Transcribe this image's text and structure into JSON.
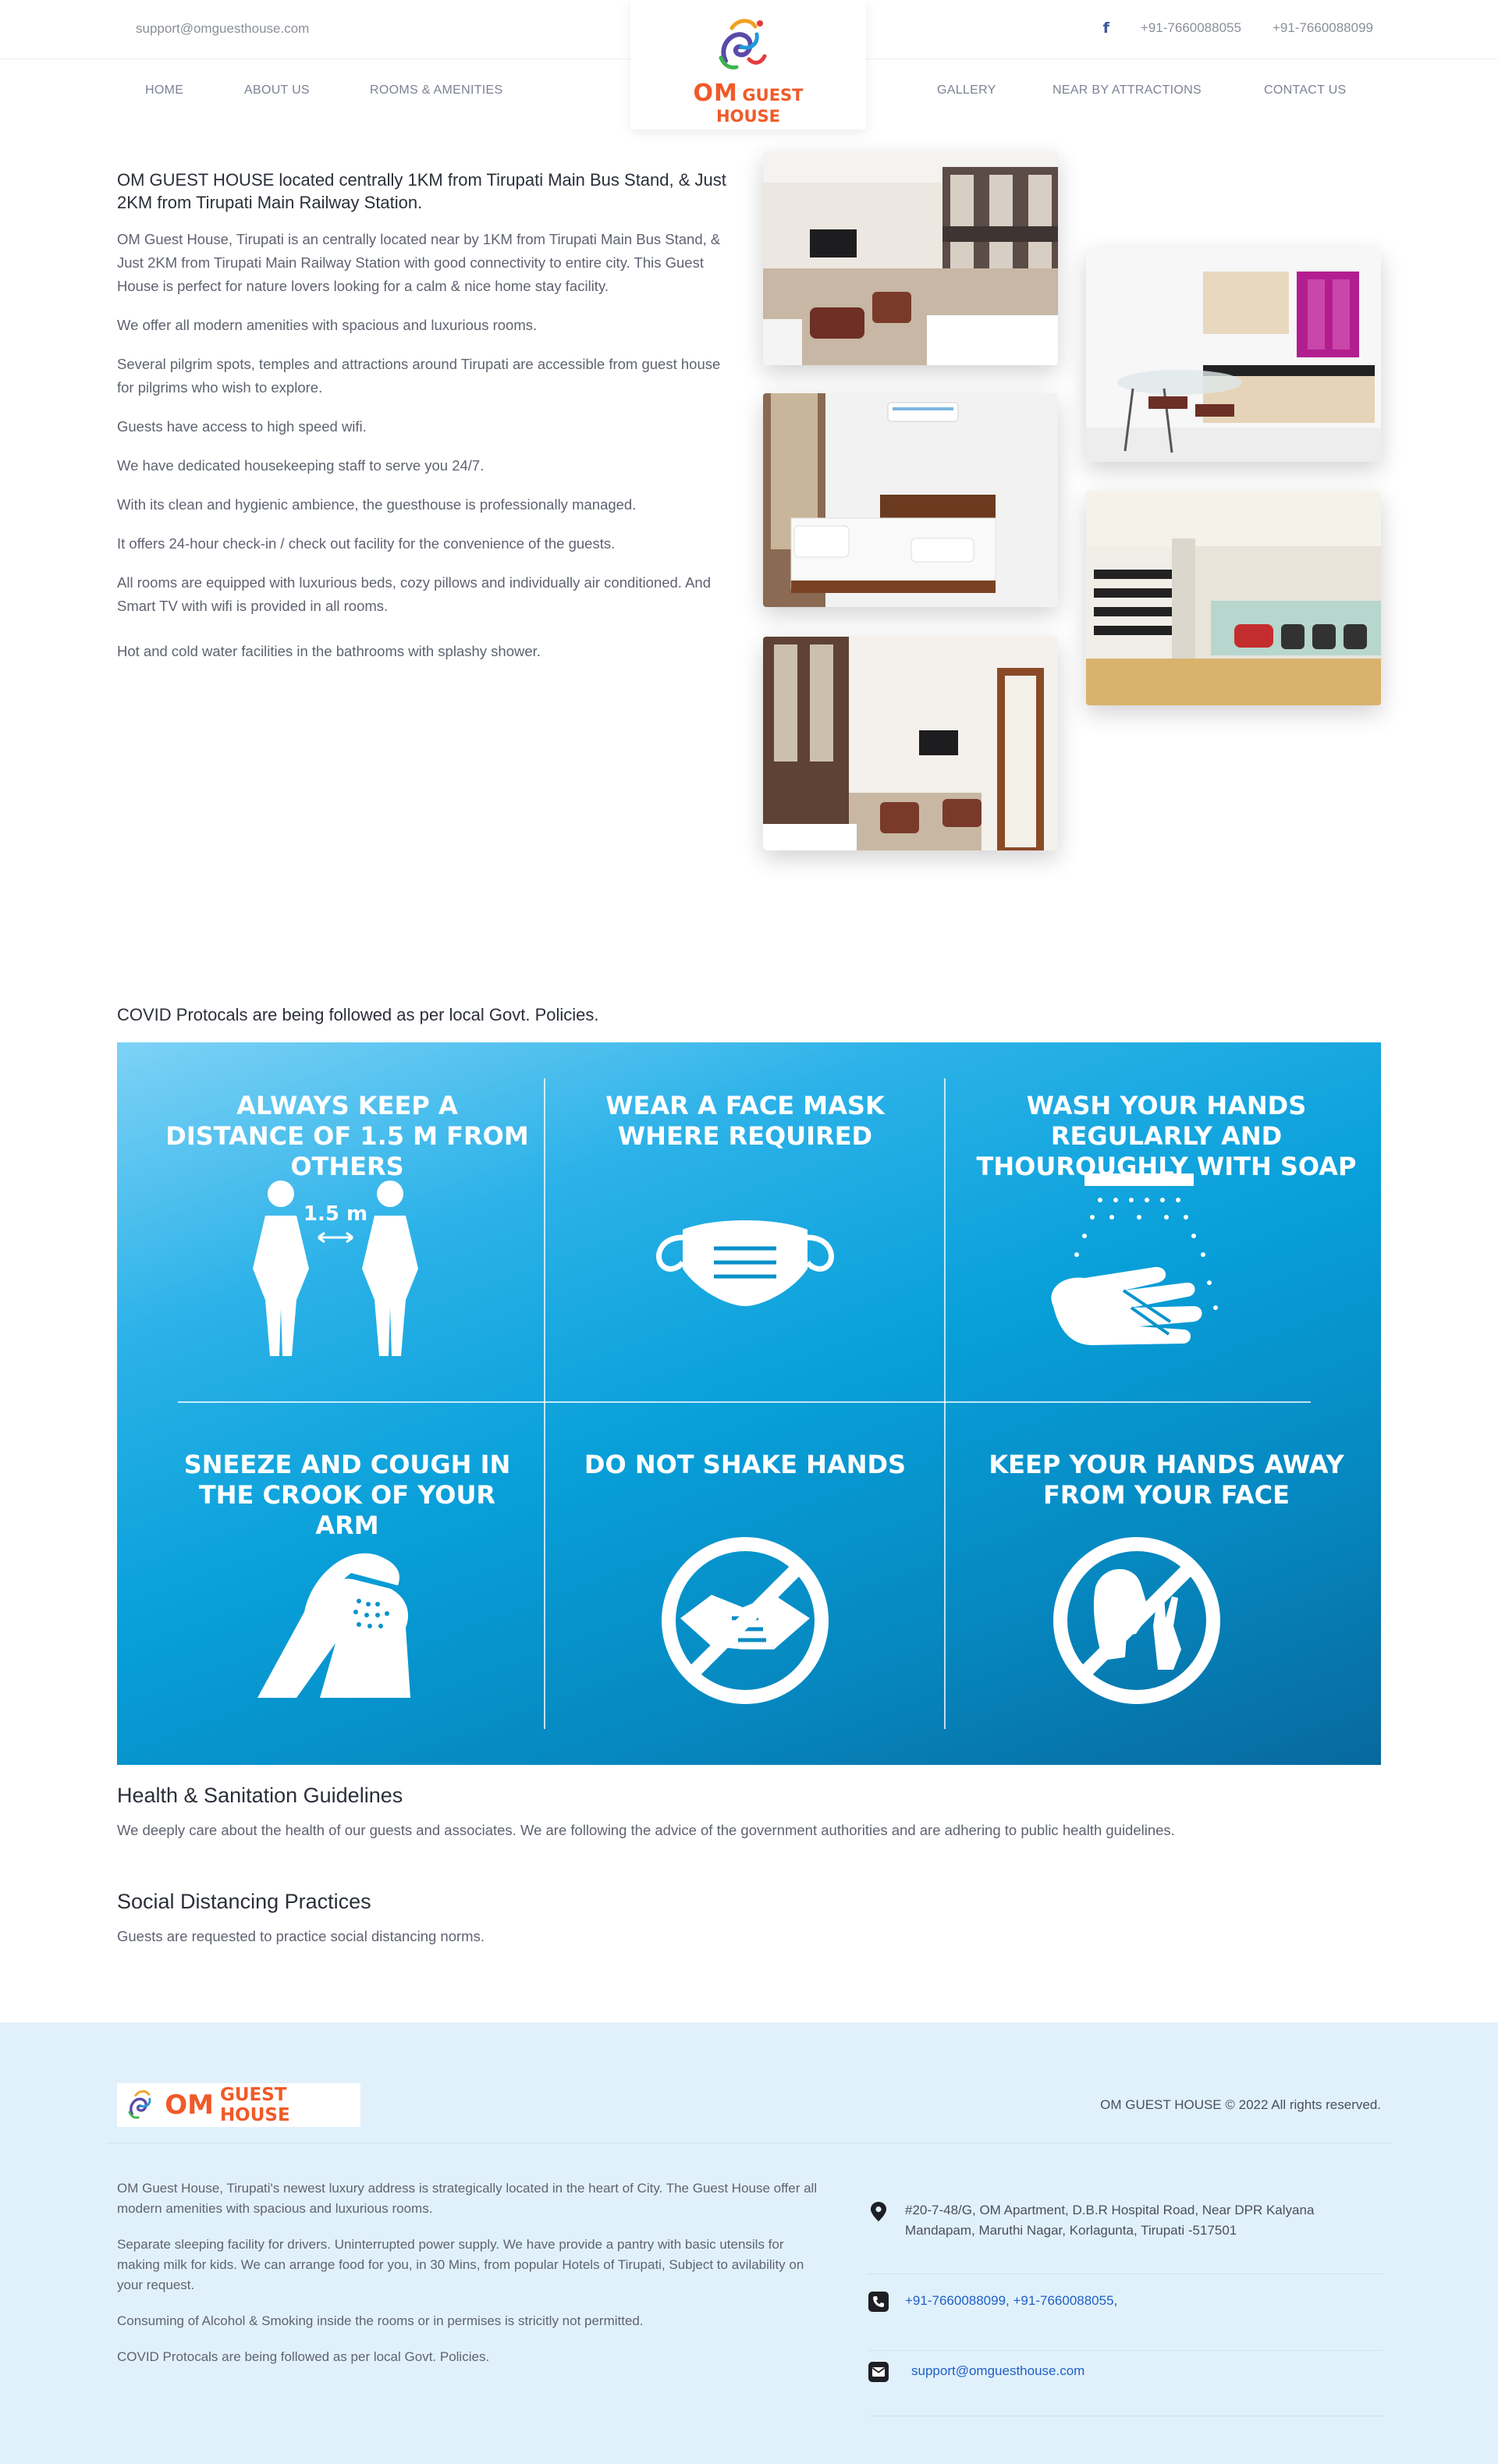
{
  "topbar": {
    "email": "support@omguesthouse.com",
    "facebook_icon": "facebook-icon",
    "phone_1": "+91-7660088055",
    "phone_2": "+91-7660088099"
  },
  "nav": {
    "home": "HOME",
    "about": "ABOUT US",
    "rooms": "ROOMS & AMENITIES",
    "gallery": "GALLERY",
    "attractions": "NEAR BY ATTRACTIONS",
    "contact": "CONTACT US"
  },
  "logo": {
    "om": "OM",
    "guest_house": "GUEST HOUSE",
    "ganesh_symbol": "ॐ"
  },
  "intro": {
    "heading": "OM GUEST HOUSE located centrally 1KM from Tirupati Main Bus Stand, & Just 2KM from Tirupati Main Railway Station.",
    "paragraphs": [
      "OM Guest House, Tirupati is an centrally located near by 1KM from Tirupati Main Bus Stand, & Just 2KM from Tirupati Main Railway Station with good connectivity to entire city. This Guest House is perfect for nature lovers looking for a calm & nice home stay facility.",
      "We offer all modern amenities with spacious and luxurious rooms.",
      "Several pilgrim spots, temples and attractions around Tirupati are accessible from guest house for pilgrims who wish to explore.",
      "Guests have access to high speed wifi.",
      "We have dedicated housekeeping staff to serve you 24/7.",
      "With its clean and hygienic ambience, the guesthouse is professionally managed.",
      "It offers 24-hour check-in / check out facility for the convenience of the guests.",
      "All rooms are equipped with luxurious beds, cozy pillows and individually air conditioned. And Smart TV with wifi is provided in all rooms.",
      "Hot and cold water facilities in the bathrooms with splashy shower."
    ]
  },
  "covid": {
    "title": "COVID Protocals are being followed as per local Govt. Policies.",
    "cells": [
      {
        "title": "ALWAYS KEEP A DISTANCE OF 1.5 M FROM OTHERS",
        "label": "1.5 m",
        "icon": "social-distance-icon"
      },
      {
        "title": "WEAR A FACE MASK WHERE REQUIRED",
        "icon": "face-mask-icon"
      },
      {
        "title": "WASH YOUR HANDS REGULARLY AND THOUROUGHLY WITH SOAP",
        "icon": "hand-wash-icon"
      },
      {
        "title": "SNEEZE AND COUGH IN THE CROOK OF YOUR ARM",
        "icon": "sneeze-arm-icon"
      },
      {
        "title": "DO NOT SHAKE HANDS",
        "icon": "no-handshake-icon"
      },
      {
        "title": "KEEP YOUR HANDS AWAY FROM YOUR FACE",
        "icon": "no-touch-face-icon"
      }
    ]
  },
  "guidelines": {
    "health_title": "Health & Sanitation Guidelines",
    "health_text": "We deeply care about the health of our guests and associates. We are following the advice of the government authorities and are adhering to public health guidelines.",
    "social_title": "Social Distancing Practices",
    "social_text": "Guests are requested to practice social distancing norms."
  },
  "footer": {
    "logo_om": "OM",
    "logo_gh": "GUEST HOUSE",
    "copyright": "OM GUEST HOUSE © 2022 All rights reserved.",
    "paragraphs": [
      "OM Guest House, Tirupati's newest luxury address is strategically located in the heart of City. The Guest House offer all modern amenities with spacious and luxurious rooms.",
      "Separate sleeping facility for drivers. Uninterrupted power supply. We have provide a pantry with basic utensils for making milk for kids. We can arrange food for you, in 30 Mins, from popular Hotels of Tirupati, Subject to avilability on your request.",
      "Consuming of Alcohol & Smoking inside the rooms or in permises is stricitly not permitted.",
      "COVID Protocals are being followed as per local Govt. Policies."
    ],
    "address": "#20-7-48/G, OM Apartment, D.B.R Hospital Road, Near DPR Kalyana Mandapam, Maruthi Nagar, Korlagunta, Tirupati -517501",
    "phone_1": "+91-7660088099",
    "phone_2": "+91-7660088055",
    "email": "support@omguesthouse.com"
  },
  "colors": {
    "accent_orange": "#f05a28",
    "covid_blue": "#089fd9",
    "footer_bg": "#e1f1fb",
    "link_blue": "#1f5fc7"
  }
}
